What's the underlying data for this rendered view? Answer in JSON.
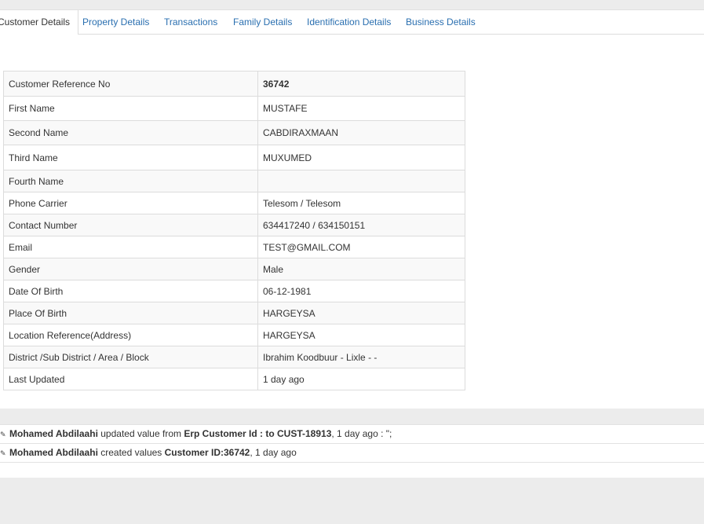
{
  "tabs": [
    {
      "label": "Customer Details"
    },
    {
      "label": "Property Details"
    },
    {
      "label": "Transactions"
    },
    {
      "label": "Family Details"
    },
    {
      "label": "Identification Details"
    },
    {
      "label": "Business Details"
    }
  ],
  "details": [
    {
      "label": "Customer Reference No",
      "value": "36742"
    },
    {
      "label": "First Name",
      "value": "MUSTAFE"
    },
    {
      "label": "Second Name",
      "value": "CABDIRAXMAAN"
    },
    {
      "label": "Third Name",
      "value": "MUXUMED"
    },
    {
      "label": "Fourth Name",
      "value": ""
    },
    {
      "label": "Phone Carrier",
      "value": "Telesom / Telesom"
    },
    {
      "label": "Contact Number",
      "value": "634417240 / 634150151"
    },
    {
      "label": "Email",
      "value": "TEST@GMAIL.COM"
    },
    {
      "label": "Gender",
      "value": "Male"
    },
    {
      "label": "Date Of Birth",
      "value": "06-12-1981"
    },
    {
      "label": "Place Of Birth",
      "value": "HARGEYSA"
    },
    {
      "label": "Location Reference(Address)",
      "value": "HARGEYSA"
    },
    {
      "label": "District /Sub District / Area / Block",
      "value": "Ibrahim Koodbuur - Lixle - -"
    },
    {
      "label": "Last Updated",
      "value": "1 day ago"
    }
  ],
  "log": [
    {
      "user": "Mohamed Abdilaahi",
      "action": "updated value from",
      "subject": "Erp Customer Id : to CUST-18913",
      "suffix": ", 1 day ago : \";"
    },
    {
      "user": "Mohamed Abdilaahi",
      "action": "created values",
      "subject": "Customer ID:36742",
      "suffix": ", 1 day ago"
    }
  ],
  "icons": {
    "log_icon": "edit-icon"
  }
}
